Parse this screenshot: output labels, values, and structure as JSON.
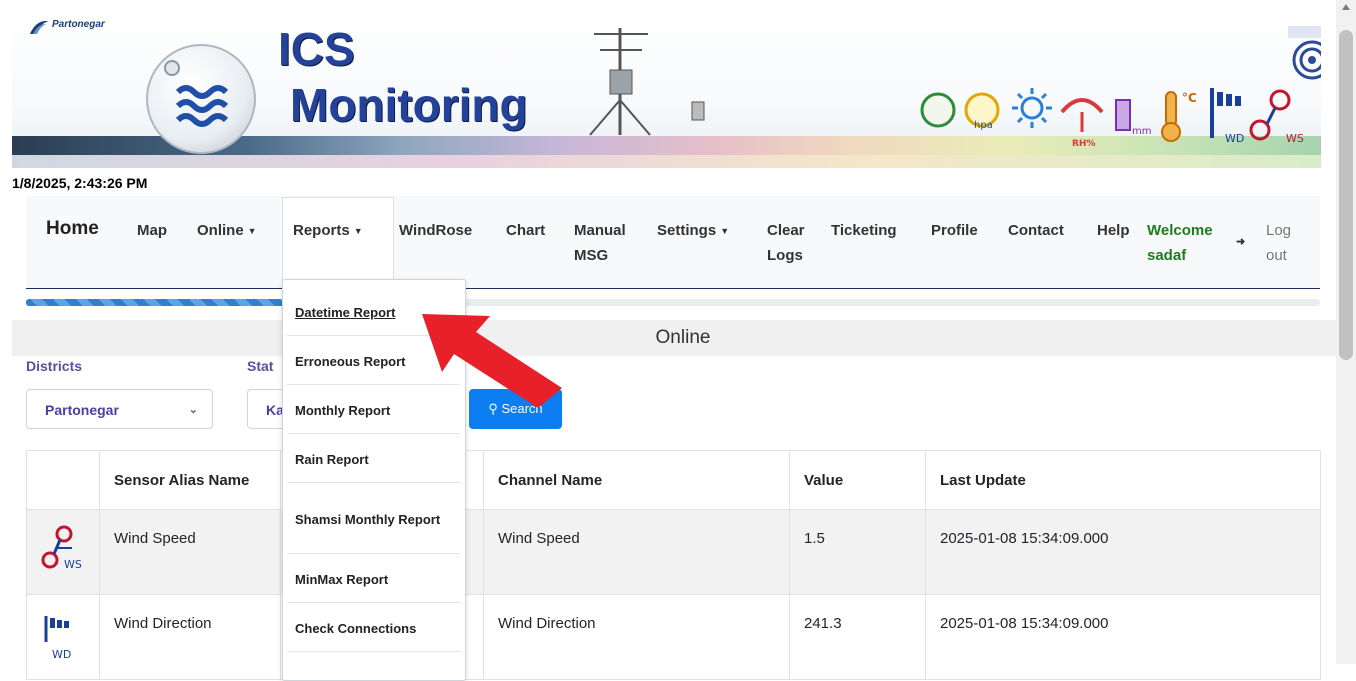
{
  "header": {
    "logo_text": "Partonegar",
    "title_line1": "ICS",
    "title_line2": "Monitoring",
    "icon_labels": [
      "hpa",
      "RH%",
      "mm",
      "°C",
      "WD",
      "WS"
    ]
  },
  "datetime": "1/8/2025, 2:43:26 PM",
  "nav": {
    "home": "Home",
    "map": "Map",
    "online": "Online",
    "reports": "Reports",
    "windrose": "WindRose",
    "chart": "Chart",
    "manual_msg_1": "Manual",
    "manual_msg_2": "MSG",
    "settings": "Settings",
    "clear_logs_1": "Clear",
    "clear_logs_2": "Logs",
    "ticketing": "Ticketing",
    "profile": "Profile",
    "contact": "Contact",
    "help": "Help",
    "welcome_1": "Welcome",
    "welcome_2": "sadaf",
    "logout_1": "Log",
    "logout_2": "out"
  },
  "reports_menu": [
    "Datetime Report",
    "Erroneous Report",
    "Monthly Report",
    "Rain Report",
    "Shamsi Monthly Report",
    "MinMax Report",
    "Check Connections"
  ],
  "page": {
    "title": "Online"
  },
  "filters": {
    "districts_label": "Districts",
    "stations_label": "Stat",
    "district_value": "Partonegar",
    "station_value": "Ka",
    "search_label": "Search"
  },
  "table": {
    "columns": [
      "",
      "Sensor Alias Name",
      "",
      "Channel Name",
      "Value",
      "Last Update"
    ],
    "rows": [
      {
        "icon": "wind-speed-icon",
        "icon_label": "WS",
        "sensor": "Wind Speed",
        "channel": "Wind Speed",
        "value": "1.5",
        "updated": "2025-01-08 15:34:09.000"
      },
      {
        "icon": "wind-direction-icon",
        "icon_label": "WD",
        "sensor": "Wind Direction",
        "channel": "Wind Direction",
        "value": "241.3",
        "updated": "2025-01-08 15:34:09.000"
      }
    ]
  },
  "colors": {
    "brand_blue": "#24429a",
    "search_blue": "#0d7ef2",
    "welcome_green": "#1e7b1e",
    "label_purple": "#5a4ea8",
    "arrow_red": "#e8202a"
  },
  "progress": 0.2
}
